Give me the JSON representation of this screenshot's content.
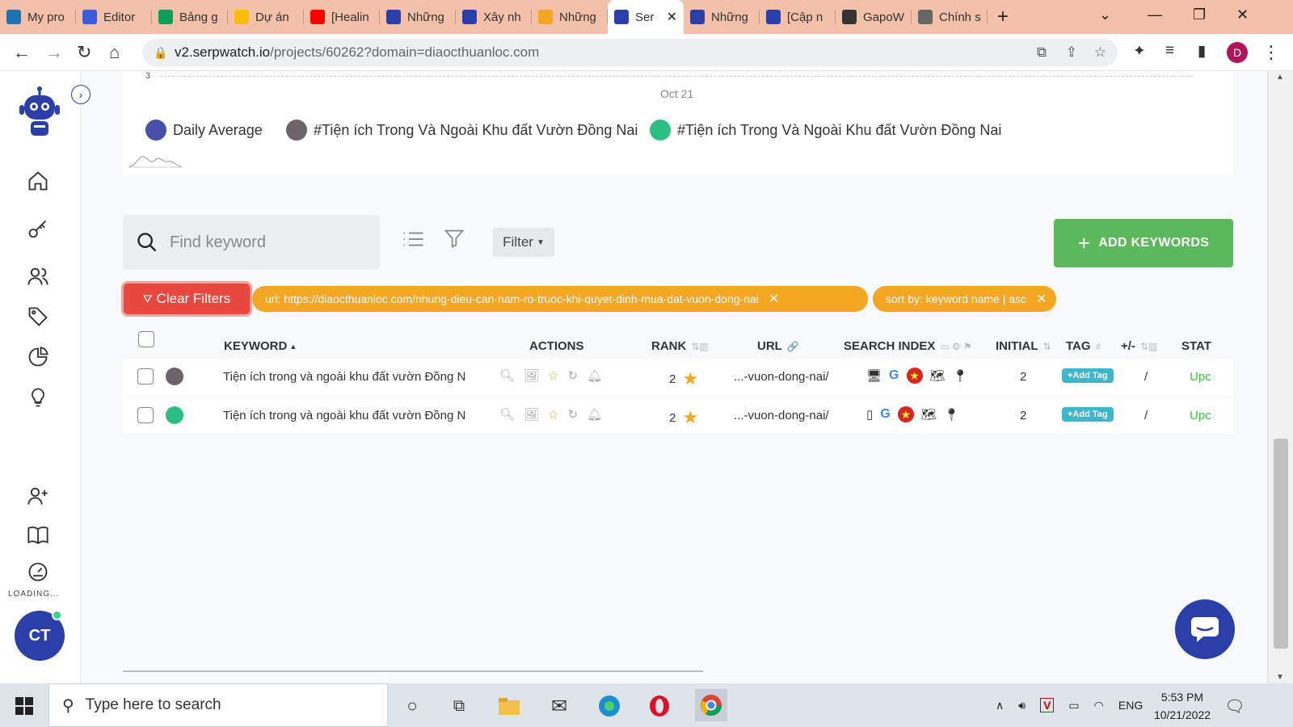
{
  "browser": {
    "tabs": [
      {
        "title": "My pro",
        "icon": "wordpress-icon",
        "color": "#2271b1"
      },
      {
        "title": "Editor",
        "icon": "wix-editor-icon",
        "color": "#3b5bdb"
      },
      {
        "title": "Bảng g",
        "icon": "google-sheets-icon",
        "color": "#0f9d58"
      },
      {
        "title": "Dự án",
        "icon": "google-drive-icon",
        "color": "#fbbc04"
      },
      {
        "title": "[Healin",
        "icon": "youtube-icon",
        "color": "#ff0000"
      },
      {
        "title": "Những",
        "icon": "serpwatch-icon",
        "color": "#2c3ea8"
      },
      {
        "title": "Xây nh",
        "icon": "serpwatch-icon",
        "color": "#2c3ea8"
      },
      {
        "title": "Những",
        "icon": "leaf-icon",
        "color": "#f5a623"
      },
      {
        "title": "Ser",
        "icon": "robot-icon",
        "color": "#2c3ea8",
        "active": true
      },
      {
        "title": "Những",
        "icon": "serpwatch-icon",
        "color": "#2c3ea8"
      },
      {
        "title": "[Cập n",
        "icon": "serpwatch-icon",
        "color": "#2c3ea8"
      },
      {
        "title": "GapoW",
        "icon": "gapo-icon",
        "color": "#333"
      },
      {
        "title": "Chính s",
        "icon": "globe-icon",
        "color": "#666"
      }
    ],
    "url_domain": "v2.serpwatch.io",
    "url_path": "/projects/60262?domain=diaocthuanloc.com",
    "profile_initial": "D"
  },
  "sidebar": {
    "loading_label": "LOADING...",
    "avatar_initials": "CT"
  },
  "chart": {
    "y_tick": "3",
    "x_tick": "Oct 21",
    "legend": [
      {
        "label": "Daily Average",
        "color": "#474fa8"
      },
      {
        "label": "#Tiện ích Trong Và Ngoài Khu đất Vườn Đồng Nai",
        "color": "#6d6469"
      },
      {
        "label": "#Tiện ích Trong Và Ngoài Khu đất Vườn Đồng Nai",
        "color": "#2bbf84"
      }
    ]
  },
  "toolbar": {
    "search_placeholder": "Find keyword",
    "filter_label": "Filter",
    "add_keywords_label": "ADD KEYWORDS",
    "clear_filters_label": "Clear Filters"
  },
  "chips": [
    {
      "label": "url: https://diaocthuanloc.com/nhung-dieu-can-nam-ro-truoc-khi-quyet-dinh-mua-dat-vuon-dong-nai"
    },
    {
      "label": "sort by: keyword name | asc"
    }
  ],
  "table": {
    "headers": {
      "keyword": "KEYWORD",
      "actions": "ACTIONS",
      "rank": "RANK",
      "url": "URL",
      "search_index": "SEARCH INDEX",
      "initial": "INITIAL",
      "tag": "TAG",
      "change": "+/-",
      "status": "STAT"
    },
    "rows": [
      {
        "dot": "#6d6469",
        "keyword": "Tiện ích trong và ngoài khu đất vườn Đồng N",
        "rank": "2",
        "url": "...-vuon-dong-nai/",
        "device": "desktop",
        "initial": "2",
        "tag": "+Add Tag",
        "change": "/",
        "status": "Upc"
      },
      {
        "dot": "#2bbf84",
        "keyword": "Tiện ích trong và ngoài khu đất vườn Đồng N",
        "rank": "2",
        "url": "...-vuon-dong-nai/",
        "device": "mobile",
        "initial": "2",
        "tag": "+Add Tag",
        "change": "/",
        "status": "Upc"
      }
    ]
  },
  "taskbar": {
    "search_placeholder": "Type here to search",
    "language": "ENG",
    "time": "5:53 PM",
    "date": "10/21/2022"
  },
  "colors": {
    "brand": "#2c3ea8",
    "green": "#5cb85c",
    "danger": "#e8483f",
    "chip": "#f5a623"
  }
}
